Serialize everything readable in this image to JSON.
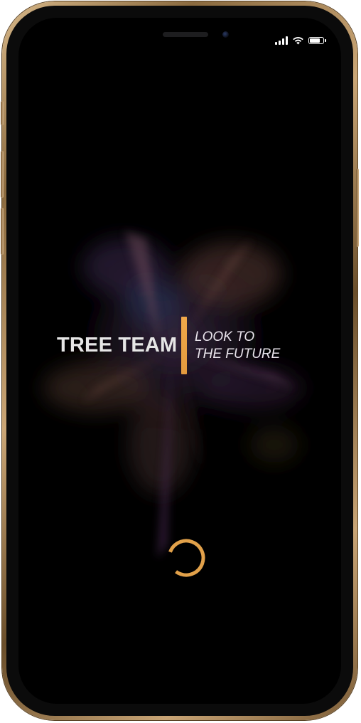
{
  "app": {
    "brand_name": "TREE TEAM",
    "tagline_line1": "LOOK TO",
    "tagline_line2": "THE FUTURE"
  },
  "status_bar": {
    "signal_icon": "cellular-signal-icon",
    "wifi_icon": "wifi-icon",
    "battery_icon": "battery-icon",
    "battery_level": 0.85
  },
  "loading": {
    "state": "loading",
    "spinner_icon": "loading-spinner-icon"
  },
  "colors": {
    "accent": "#f0a84a",
    "background": "#000000",
    "brand_text": "#e6e6e6",
    "frame_gold": "#c9a576"
  }
}
